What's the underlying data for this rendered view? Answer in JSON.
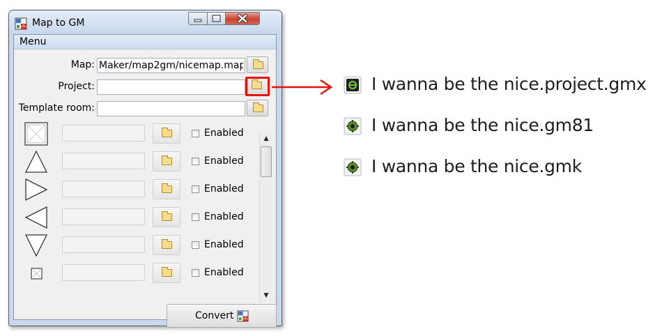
{
  "window": {
    "title": "Map to GM",
    "app_icon": "map2gm-brick-icon",
    "controls": [
      "minimize-icon",
      "maximize-icon",
      "close-icon"
    ]
  },
  "menu": {
    "label": "Menu"
  },
  "form": {
    "map_label": "Map:",
    "map_value": "Maker/map2gm/nicemap.map",
    "project_label": "Project:",
    "project_value": "",
    "template_label": "Template room:",
    "template_value": ""
  },
  "objects": [
    {
      "shape": "block-square-icon",
      "value": "",
      "enabled_label": "Enabled",
      "enabled": false
    },
    {
      "shape": "spike-up-icon",
      "value": "",
      "enabled_label": "Enabled",
      "enabled": false
    },
    {
      "shape": "spike-right-icon",
      "value": "",
      "enabled_label": "Enabled",
      "enabled": false
    },
    {
      "shape": "spike-left-icon",
      "value": "",
      "enabled_label": "Enabled",
      "enabled": false
    },
    {
      "shape": "spike-down-icon",
      "value": "",
      "enabled_label": "Enabled",
      "enabled": false
    },
    {
      "shape": "mini-block-icon",
      "value": "",
      "enabled_label": "Enabled",
      "enabled": false
    }
  ],
  "convert": {
    "label": "Convert"
  },
  "colors": {
    "highlight": "#e8130e",
    "gmx_icon": "#1f1f1f",
    "gm_green": "#5a8a2a"
  },
  "files": [
    {
      "name": "I wanna be the nice.project.gmx",
      "icon": "gmx-file-icon"
    },
    {
      "name": "I wanna be the nice.gm81",
      "icon": "gm81-file-icon"
    },
    {
      "name": "I wanna be the nice.gmk",
      "icon": "gmk-file-icon"
    }
  ]
}
